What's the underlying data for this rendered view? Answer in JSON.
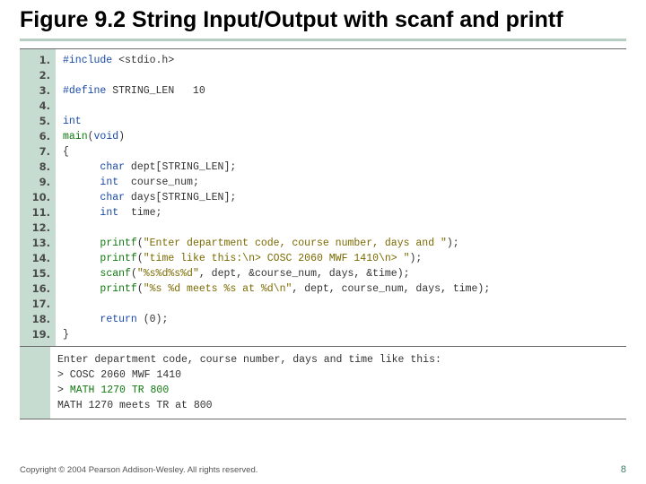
{
  "title_bold": "Figure 9.2",
  "title_rest": "  String Input/Output with scanf and printf",
  "code_lines": [
    {
      "n": "1.",
      "seg": [
        [
          "kw",
          "#include"
        ],
        [
          "",
          " <stdio.h>"
        ]
      ]
    },
    {
      "n": "2.",
      "seg": [
        [
          "",
          ""
        ]
      ]
    },
    {
      "n": "3.",
      "seg": [
        [
          "kw",
          "#define"
        ],
        [
          "",
          " STRING_LEN   10"
        ]
      ]
    },
    {
      "n": "4.",
      "seg": [
        [
          "",
          ""
        ]
      ]
    },
    {
      "n": "5.",
      "seg": [
        [
          "kw",
          "int"
        ]
      ]
    },
    {
      "n": "6.",
      "seg": [
        [
          "fn",
          "main"
        ],
        [
          "",
          "("
        ],
        [
          "kw",
          "void"
        ],
        [
          "",
          ")"
        ]
      ]
    },
    {
      "n": "7.",
      "seg": [
        [
          "",
          "{"
        ]
      ]
    },
    {
      "n": "8.",
      "seg": [
        [
          "",
          "      "
        ],
        [
          "kw",
          "char"
        ],
        [
          "",
          " dept[STRING_LEN];"
        ]
      ]
    },
    {
      "n": "9.",
      "seg": [
        [
          "",
          "      "
        ],
        [
          "kw",
          "int"
        ],
        [
          "",
          "  course_num;"
        ]
      ]
    },
    {
      "n": "10.",
      "seg": [
        [
          "",
          "      "
        ],
        [
          "kw",
          "char"
        ],
        [
          "",
          " days[STRING_LEN];"
        ]
      ]
    },
    {
      "n": "11.",
      "seg": [
        [
          "",
          "      "
        ],
        [
          "kw",
          "int"
        ],
        [
          "",
          "  time;"
        ]
      ]
    },
    {
      "n": "12.",
      "seg": [
        [
          "",
          ""
        ]
      ]
    },
    {
      "n": "13.",
      "seg": [
        [
          "",
          "      "
        ],
        [
          "fn",
          "printf"
        ],
        [
          "",
          "("
        ],
        [
          "str",
          "\"Enter department code, course number, days and \""
        ],
        [
          "",
          ");"
        ]
      ]
    },
    {
      "n": "14.",
      "seg": [
        [
          "",
          "      "
        ],
        [
          "fn",
          "printf"
        ],
        [
          "",
          "("
        ],
        [
          "str",
          "\"time like this:\\n> COSC 2060 MWF 1410\\n> \""
        ],
        [
          "",
          ");"
        ]
      ]
    },
    {
      "n": "15.",
      "seg": [
        [
          "",
          "      "
        ],
        [
          "fn",
          "scanf"
        ],
        [
          "",
          "("
        ],
        [
          "str",
          "\"%s%d%s%d\""
        ],
        [
          "",
          ", dept, &course_num, days, &time);"
        ]
      ]
    },
    {
      "n": "16.",
      "seg": [
        [
          "",
          "      "
        ],
        [
          "fn",
          "printf"
        ],
        [
          "",
          "("
        ],
        [
          "str",
          "\"%s %d meets %s at %d\\n\""
        ],
        [
          "",
          ", dept, course_num, days, time);"
        ]
      ]
    },
    {
      "n": "17.",
      "seg": [
        [
          "",
          ""
        ]
      ]
    },
    {
      "n": "18.",
      "seg": [
        [
          "",
          "      "
        ],
        [
          "kw",
          "return"
        ],
        [
          "",
          " (0);"
        ]
      ]
    },
    {
      "n": "19.",
      "seg": [
        [
          "",
          "}"
        ]
      ]
    }
  ],
  "output_lines": [
    [
      [
        "",
        "Enter department code, course number, days and time like this:"
      ]
    ],
    [
      [
        "",
        "> COSC 2060 MWF 1410"
      ]
    ],
    [
      [
        "",
        "> "
      ],
      [
        "fn",
        "MATH 1270 TR 800"
      ]
    ],
    [
      [
        "",
        "MATH 1270 meets TR at 800"
      ]
    ]
  ],
  "footer": "Copyright © 2004 Pearson Addison-Wesley. All rights reserved.",
  "pagenum": "8"
}
